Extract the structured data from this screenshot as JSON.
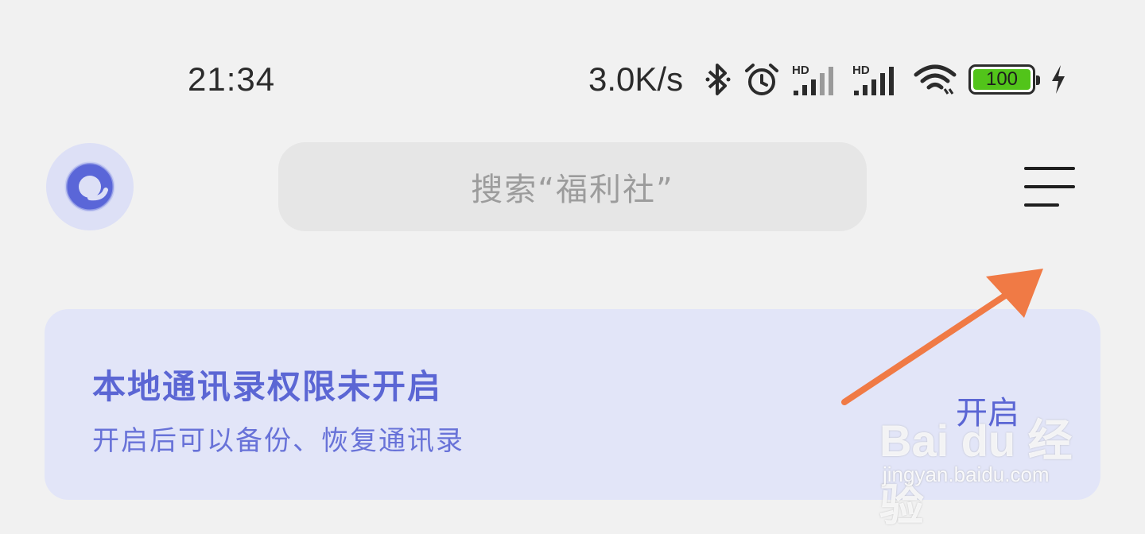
{
  "status_bar": {
    "time": "21:34",
    "net_speed": "3.0K/s",
    "battery_level": "100",
    "icons": [
      "bluetooth-icon",
      "alarm-icon",
      "signal-hd-1-icon",
      "signal-hd-2-icon",
      "wifi-icon",
      "battery-icon",
      "charging-icon"
    ],
    "signal_badge": "HD"
  },
  "header": {
    "logo_icon": "app-logo-icon",
    "search_placeholder": "搜索“福利社”",
    "menu_icon": "hamburger-menu-icon"
  },
  "permission_card": {
    "title": "本地通讯录权限未开启",
    "description": "开启后可以备份、恢复通讯录",
    "action_label": "开启"
  },
  "annotation": {
    "arrow_color": "#f07a45"
  },
  "watermark": {
    "logo_text": "Bai du 经验",
    "url": "jingyan.baidu.com"
  },
  "colors": {
    "background": "#f1f1f1",
    "card_background": "#e2e5f8",
    "accent": "#5b66d4",
    "battery_fill": "#52c41a"
  }
}
